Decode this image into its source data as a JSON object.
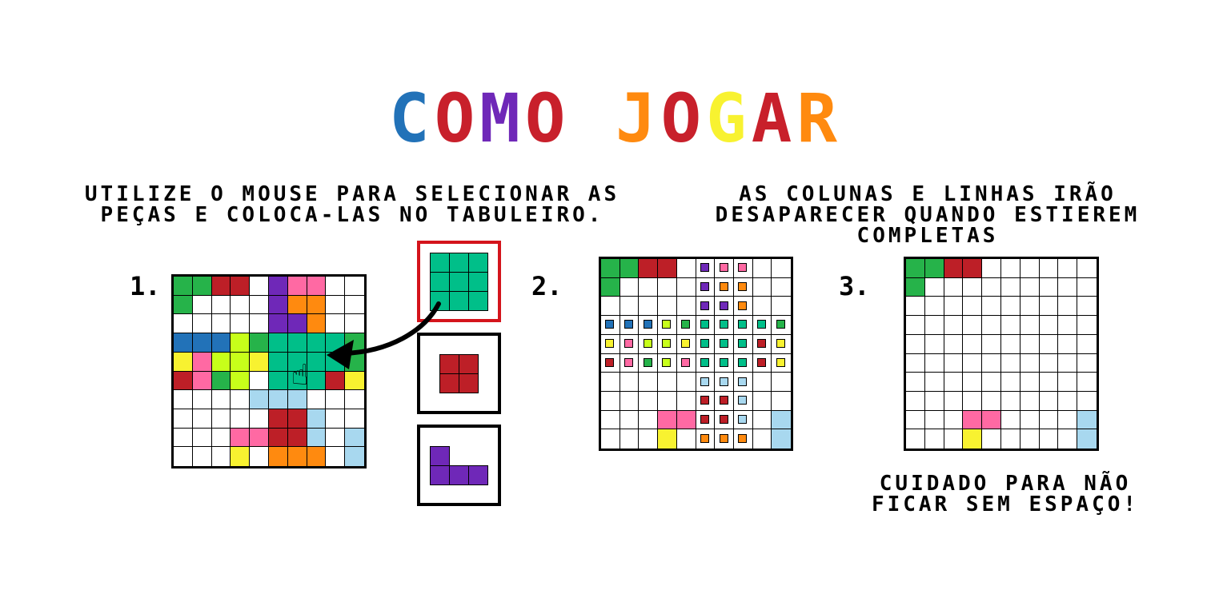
{
  "title": {
    "text": "COMO JOGAR",
    "letter_colors": [
      "#2272b8",
      "#c8202b",
      "#6f28b8",
      "#c8202b",
      "#ffffff",
      "#ff8a0f",
      "#c8202b",
      "#f8f230",
      "#c8202b",
      "#ff8a0f"
    ]
  },
  "colors": {
    "G": "#26b34a",
    "R": "#bd1f27",
    "P": "#6f28b8",
    "K": "#ff69a3",
    "O": "#ff8a0f",
    "B": "#2272b8",
    "L": "#c7ff1a",
    "T": "#00bf89",
    "Y": "#f8f230",
    "S": "#a8d8ef",
    "W": "#ffffff",
    "selection_border": "#d4141c"
  },
  "instructions": {
    "left": "Utilize o mouse para selecionar as peças e coloca-las no tabuleiro.",
    "right": "As colunas e linhas irão desaparecer quando estierem completas",
    "warning": "Cuidado para não ficar sem espaço!"
  },
  "steps": {
    "one": "1.",
    "two": "2.",
    "three": "3."
  },
  "board1": [
    "GGRRWPKKWW",
    "GWWWWPOOWW",
    "WWWWWPPOWW",
    "BBBLGTTTTG",
    "YKLLYTTTTG",
    "RKGLWTTTRY",
    "WWWWSSSWWW",
    "WWWWWRRSWW",
    "WWWKKRRSWS",
    "WWWYWOOOWS"
  ],
  "board2_fills": [
    "GGRRWWWWWW",
    "GWWWWWWWWW",
    "WWWWWWWWWW",
    "WWWWWWWWWW",
    "WWWWWWWWWW",
    "WWWWWWWWWW",
    "WWWWWWWWWW",
    "WWWWWWWWWW",
    "WWWKKWWWWS",
    "WWWYWWWWWS"
  ],
  "board2_dots": [
    "WWWWWPKKWW",
    "WWWWWPOOWW",
    "WWWWWPPOWW",
    "BBBLGTTTTG",
    "YKLLYTTTRY",
    "RKGLKTTTRY",
    "WWWWWSSSWW",
    "WWWWWRRSWW",
    "WWWWWRRSWW",
    "WWWWWOOOWW"
  ],
  "board3": [
    "GGRRWWWWWW",
    "GWWWWWWWWW",
    "WWWWWWWWWW",
    "WWWWWWWWWW",
    "WWWWWWWWWW",
    "WWWWWWWWWW",
    "WWWWWWWWWW",
    "WWWWWWWWWW",
    "WWWKKWWWWS",
    "WWWYWWWWWS"
  ],
  "pieces": [
    {
      "name": "piece-teal-3x3",
      "shape": [
        "TTT",
        "TTT",
        "TTT"
      ],
      "selected": true
    },
    {
      "name": "piece-red-2x2",
      "shape": [
        "RR",
        "RR"
      ],
      "selected": false
    },
    {
      "name": "piece-purple-l",
      "shape": [
        "PW W",
        "PPP"
      ],
      "selected": false
    }
  ]
}
